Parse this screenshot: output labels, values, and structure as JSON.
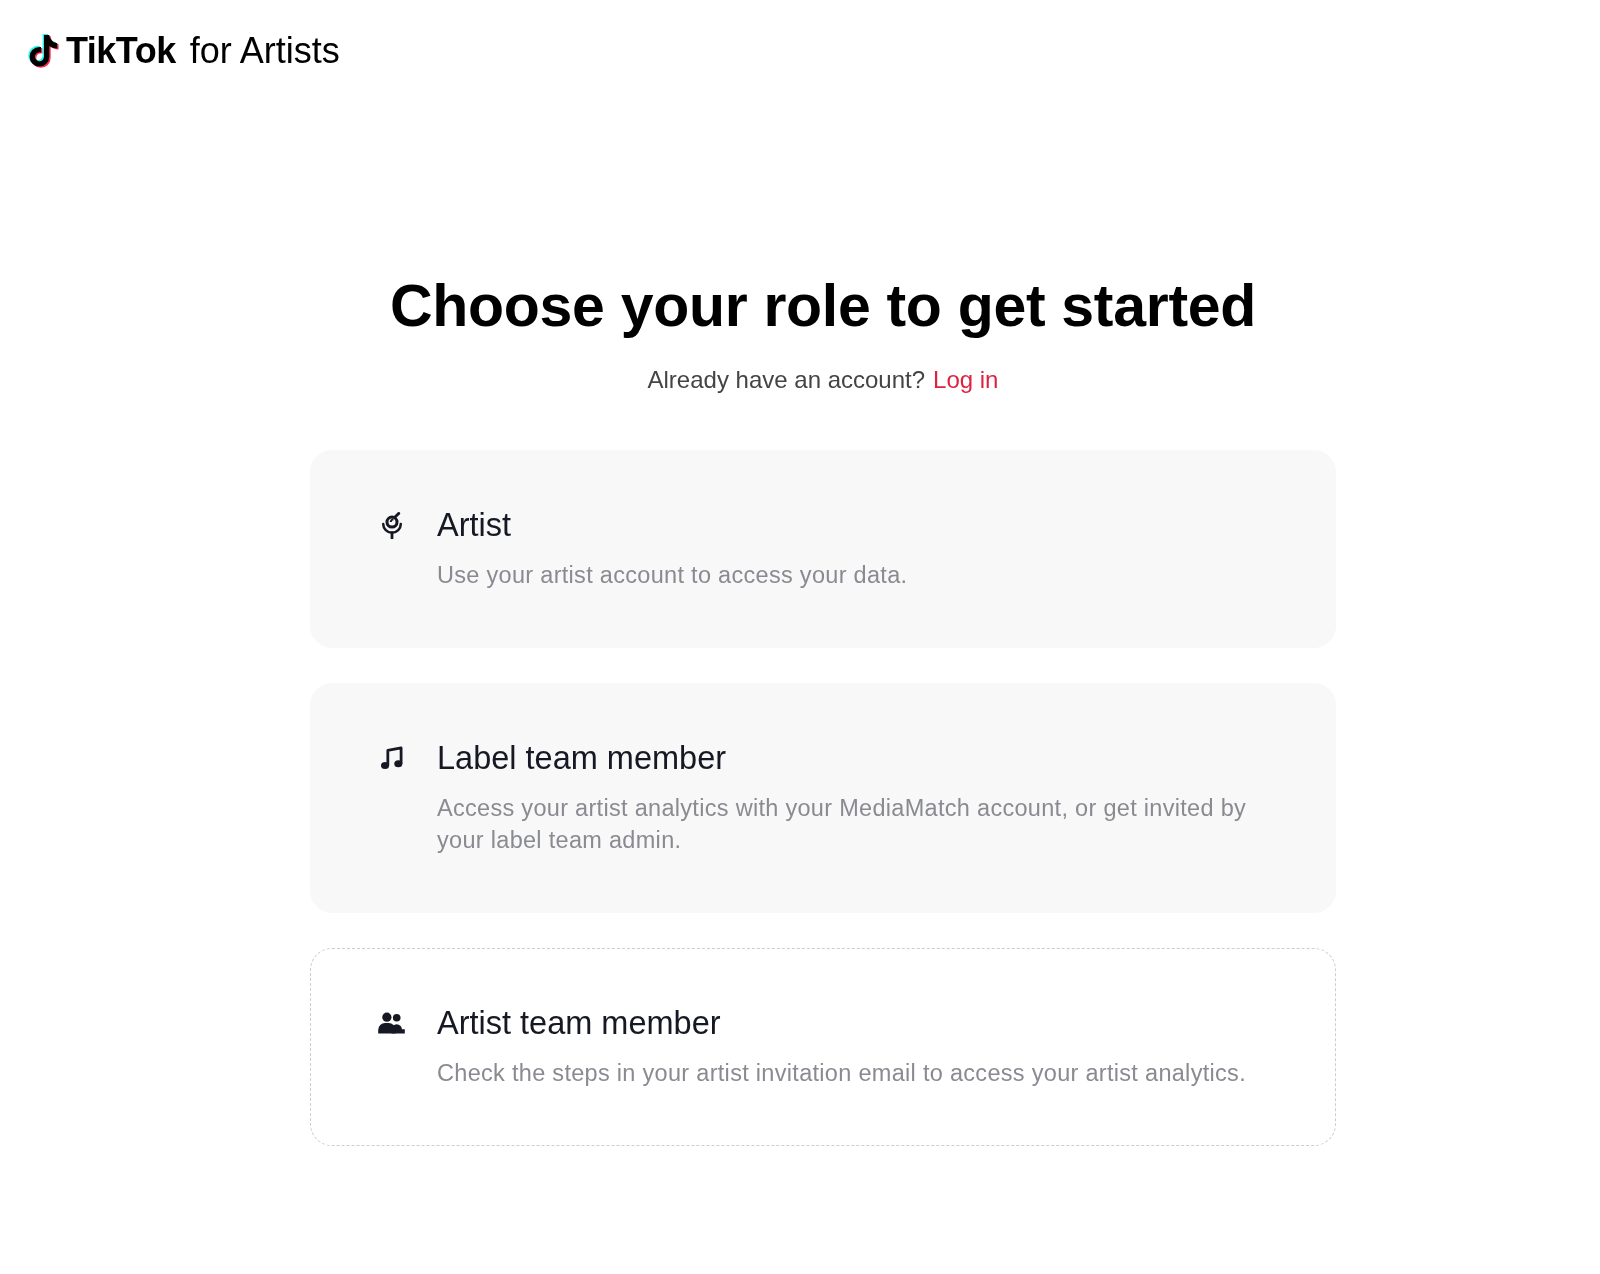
{
  "header": {
    "brand": "TikTok",
    "product": "for Artists"
  },
  "heading": "Choose your role to get started",
  "login_prompt": {
    "text": "Already have an account?",
    "link": "Log in"
  },
  "roles": [
    {
      "kind": "filled",
      "title": "Artist",
      "description": "Use your artist account to access your data."
    },
    {
      "kind": "filled",
      "title": "Label team member",
      "description": "Access your artist analytics with your MediaMatch account, or get invited by your label team admin."
    },
    {
      "kind": "dashed",
      "title": "Artist team member",
      "description": "Check the steps in your artist invitation email to access your artist analytics."
    }
  ]
}
